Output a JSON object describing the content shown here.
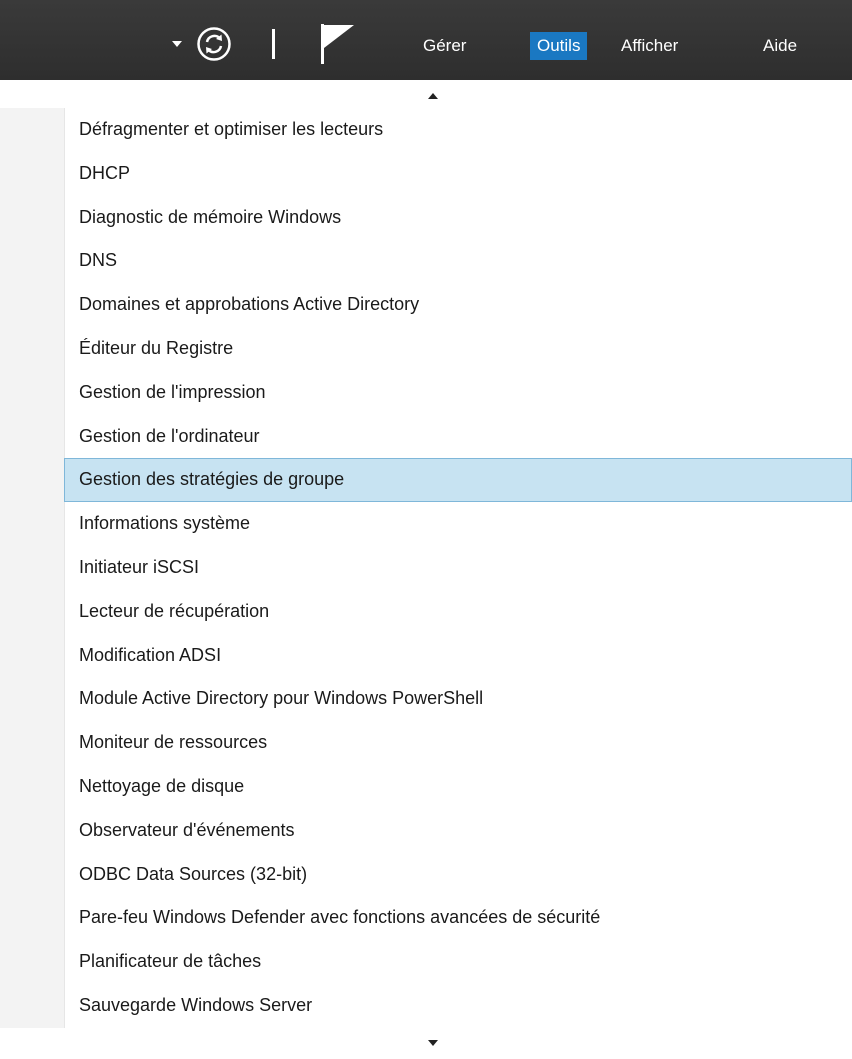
{
  "toolbar": {
    "dropdown_icon": "caret-down-icon",
    "refresh_icon": "refresh-icon",
    "flag_icon": "flag-icon",
    "menus": [
      {
        "label": "Gérer",
        "active": false
      },
      {
        "label": "Outils",
        "active": true
      },
      {
        "label": "Afficher",
        "active": false
      },
      {
        "label": "Aide",
        "active": false
      }
    ],
    "colors": {
      "bar_background": "#333333",
      "active_menu": "#1a78c2",
      "hover_item_background": "#c7e3f2",
      "hover_item_border": "#7fb7d9"
    }
  },
  "tools_menu": {
    "items": [
      {
        "label": "Défragmenter et optimiser les lecteurs"
      },
      {
        "label": "DHCP"
      },
      {
        "label": "Diagnostic de mémoire Windows"
      },
      {
        "label": "DNS"
      },
      {
        "label": "Domaines et approbations Active Directory"
      },
      {
        "label": "Éditeur du Registre"
      },
      {
        "label": "Gestion de l'impression"
      },
      {
        "label": "Gestion de l'ordinateur"
      },
      {
        "label": "Gestion des stratégies de groupe",
        "hovered": true
      },
      {
        "label": "Informations système"
      },
      {
        "label": "Initiateur iSCSI"
      },
      {
        "label": "Lecteur de récupération"
      },
      {
        "label": "Modification ADSI"
      },
      {
        "label": "Module Active Directory pour Windows PowerShell"
      },
      {
        "label": "Moniteur de ressources"
      },
      {
        "label": "Nettoyage de disque"
      },
      {
        "label": "Observateur d'événements"
      },
      {
        "label": "ODBC Data Sources (32-bit)"
      },
      {
        "label": "Pare-feu Windows Defender avec fonctions avancées de sécurité"
      },
      {
        "label": "Planificateur de tâches"
      },
      {
        "label": "Sauvegarde Windows Server"
      }
    ]
  }
}
